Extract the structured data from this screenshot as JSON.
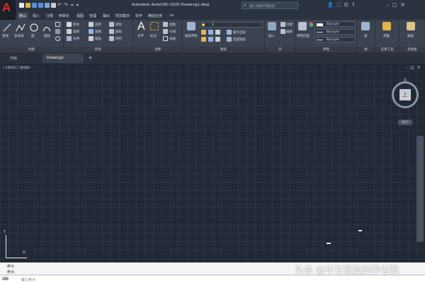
{
  "app": {
    "logo_letter": "A",
    "title": "Autodesk AutoCAD 2020   Drawing1.dwg",
    "search_placeholder": "键入关键字或短语"
  },
  "menu_tabs": [
    "默认",
    "插入",
    "注释",
    "参数化",
    "视图",
    "管理",
    "输出",
    "附加模块",
    "协作",
    "精选应用"
  ],
  "ribbon": {
    "draw": {
      "panel": "绘图",
      "line": "直线",
      "polyline": "多段线",
      "circle": "圆",
      "arc": "圆弧"
    },
    "modify": {
      "panel": "修改",
      "move": "移动",
      "rotate": "旋转",
      "trim": "修剪",
      "copy": "复制",
      "mirror": "镜像",
      "fillet": "圆角",
      "stretch": "拉伸",
      "scale": "缩放",
      "array": "阵列"
    },
    "annotation": {
      "panel": "注释",
      "text": "文字",
      "dimension": "标注",
      "linear": "线性",
      "leader": "引线",
      "table": "表格"
    },
    "layers": {
      "panel": "图层",
      "layer_props": "图层特性",
      "layer_value": "0",
      "make_current": "置为当前",
      "match": "匹配图层"
    },
    "block": {
      "panel": "块",
      "insert": "插入",
      "create": "创建",
      "edit": "编辑"
    },
    "properties": {
      "panel": "特性",
      "match": "特性匹配",
      "bylayer1": "ByLayer",
      "bylayer2": "ByLayer",
      "bylayer3": "ByLayer"
    },
    "groups": {
      "panel": "组",
      "group": "组"
    },
    "utilities": {
      "panel": "实用工具",
      "measure": "测量"
    },
    "clipboard": {
      "panel": "剪贴板",
      "paste": "粘贴"
    }
  },
  "file_tabs": [
    "开始",
    "Drawing1"
  ],
  "canvas": {
    "viewport_label": "[-][俯视][二维线框]",
    "viewcube_face": "上",
    "compass_north": "北",
    "wcs": "WCS",
    "ucs_x": "X",
    "ucs_y": "Y"
  },
  "command": {
    "history1": "命令:",
    "history2": "命令:",
    "placeholder": "键入命令"
  },
  "watermark": "头条 @不甘寂寞的养老院",
  "colors": {
    "accent": "#e5262b",
    "canvas_bg": "#212836",
    "ribbon_bg": "#3b4350"
  }
}
